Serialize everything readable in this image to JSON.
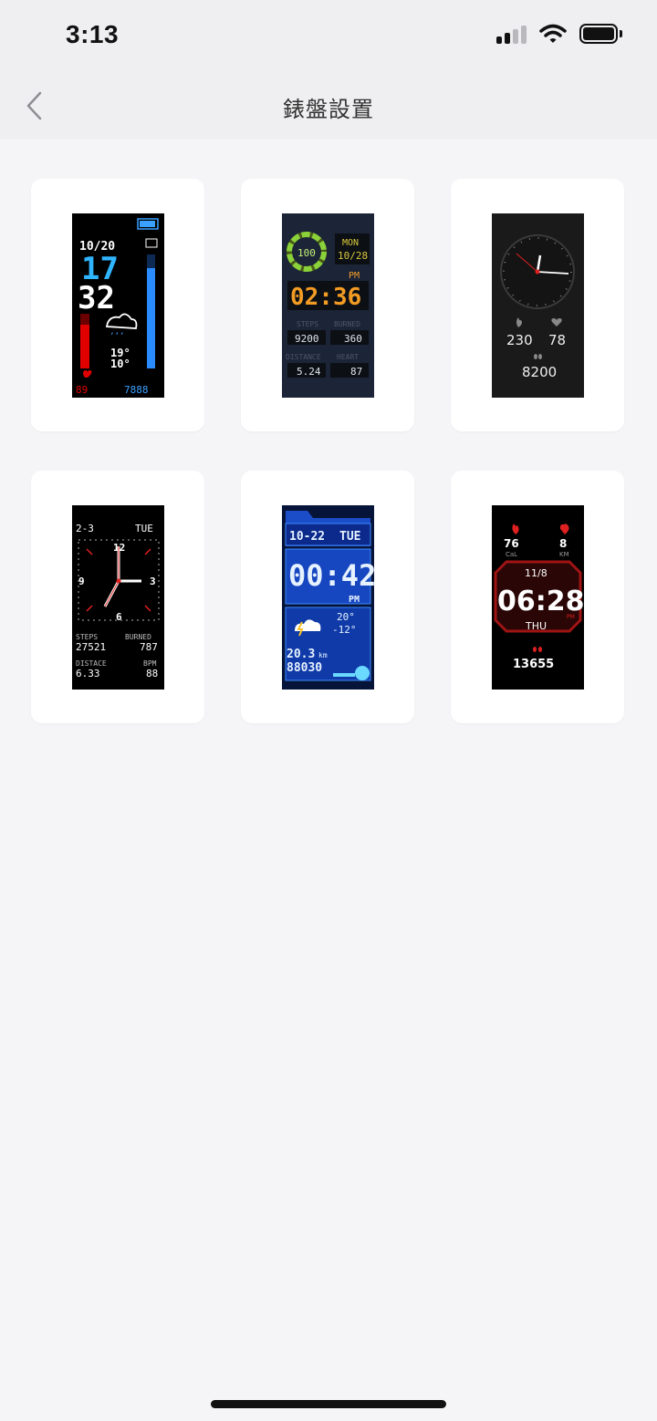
{
  "status_bar": {
    "time": "3:13"
  },
  "nav": {
    "title": "錶盤設置"
  },
  "faces": [
    {
      "date": "10/20",
      "hour": "17",
      "minute": "32",
      "temp_high": "19°",
      "temp_low": "10°",
      "heart": "89",
      "steps": "7888"
    },
    {
      "battery": "100",
      "day": "MON",
      "date": "10/28",
      "ampm": "PM",
      "time": "02:36",
      "steps_label": "STEPS",
      "burned_label": "BURNED",
      "steps": "9200",
      "burned": "360",
      "distance_label": "DISTANCE",
      "heart_label": "HEART",
      "distance": "5.24",
      "heart": "87"
    },
    {
      "calories": "230",
      "heart": "78",
      "steps": "8200"
    },
    {
      "date": "2-3",
      "day": "TUE",
      "n12": "12",
      "n3": "3",
      "n6": "6",
      "n9": "9",
      "steps_label": "STEPS",
      "burned_label": "BURNED",
      "steps": "27521",
      "burned": "787",
      "distance_label": "DISTACE",
      "bpm_label": "BPM",
      "distance": "6.33",
      "bpm": "88"
    },
    {
      "date": "10-22",
      "day": "TUE",
      "time": "00:42",
      "ampm": "PM",
      "temp_high": "20°",
      "temp_low": "-12°",
      "distance": "20.3",
      "distance_unit": "km",
      "steps": "88030"
    },
    {
      "calories": "76",
      "cal_label": "CaL",
      "distance": "8",
      "km_label": "KM",
      "date": "11/8",
      "time": "06:28",
      "ampm": "PM",
      "day": "THU",
      "steps": "13655"
    }
  ]
}
